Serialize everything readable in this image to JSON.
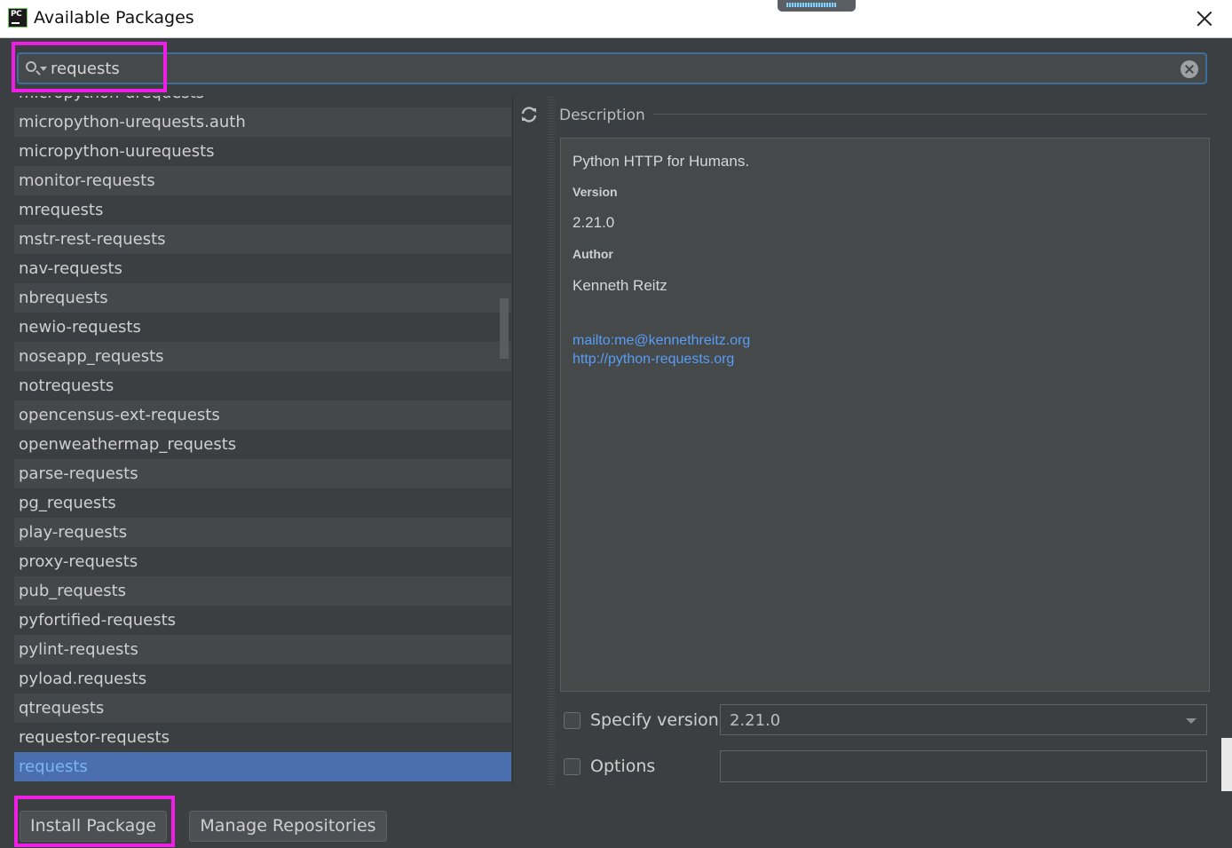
{
  "window": {
    "title": "Available Packages",
    "app_icon_text": "PC"
  },
  "search": {
    "value": "requests"
  },
  "packages": [
    "micropython-urequests",
    "micropython-urequests.auth",
    "micropython-uurequests",
    "monitor-requests",
    "mrequests",
    "mstr-rest-requests",
    "nav-requests",
    "nbrequests",
    "newio-requests",
    "noseapp_requests",
    "notrequests",
    "opencensus-ext-requests",
    "openweathermap_requests",
    "parse-requests",
    "pg_requests",
    "play-requests",
    "proxy-requests",
    "pub_requests",
    "pyfortified-requests",
    "pylint-requests",
    "pyload.requests",
    "qtrequests",
    "requestor-requests",
    "requests"
  ],
  "selected_package": "requests",
  "description": {
    "label": "Description",
    "summary": "Python HTTP for Humans.",
    "version_key": "Version",
    "version_value": "2.21.0",
    "author_key": "Author",
    "author_value": "Kenneth Reitz",
    "links": [
      "mailto:me@kennethreitz.org",
      "http://python-requests.org"
    ]
  },
  "options": {
    "specify_version_label": "Specify version",
    "specify_version_checked": false,
    "version_value": "2.21.0",
    "options_label": "Options",
    "options_checked": false,
    "options_value": ""
  },
  "buttons": {
    "install": "Install Package",
    "manage": "Manage Repositories"
  },
  "colors": {
    "background": "#3c3f41",
    "selection": "#4b6eaf",
    "link": "#589df6",
    "highlight": "#ee1ee6"
  }
}
